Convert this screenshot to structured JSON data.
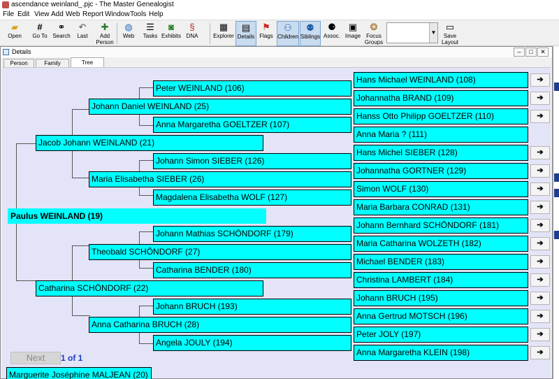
{
  "title_bar": {
    "text": "ascendance weinland_.pjc - The Master Genealogist"
  },
  "menu": [
    "File",
    "Edit",
    "View",
    "Add",
    "Web",
    "Report",
    "Window",
    "Tools",
    "Help"
  ],
  "toolbar": {
    "open": "Open",
    "go_to": "Go To",
    "search": "Search",
    "last": "Last",
    "add_person_1": "Add",
    "add_person_2": "Person",
    "web": "Web",
    "tasks": "Tasks",
    "exhibits": "Exhibits",
    "dna": "DNA",
    "explorer": "Explorer",
    "details": "Details",
    "flags": "Flags",
    "children": "Children",
    "siblings": "Siblings",
    "assoc": "Assoc.",
    "image": "Image",
    "focus_groups_1": "Focus",
    "focus_groups_2": "Groups",
    "save_layout_1": "Save",
    "save_layout_2": "Layout"
  },
  "details_window": {
    "title": "Details",
    "tabs": [
      "Person",
      "Family",
      "Tree"
    ],
    "active_tab": "Tree"
  },
  "tree": {
    "root": "Paulus WEINLAND (19)",
    "generation2": [
      "Jacob Johann WEINLAND (21)",
      "Catharina SCHÖNDORF (22)"
    ],
    "generation3": [
      "Johann Daniel WEINLAND (25)",
      "Maria Elisabetha SIEBER (26)",
      "Theobald SCHÖNDORF (27)",
      "Anna Catharina BRUCH (28)"
    ],
    "generation4": [
      "Peter WEINLAND (106)",
      "Anna Margaretha GOELTZER (107)",
      "Johann Simon SIEBER (126)",
      "Magdalena Elisabetha WOLF (127)",
      "Johann Mathias SCHÖNDORF (179)",
      "Catharina BENDER (180)",
      "Johann BRUCH (193)",
      "Angela JOULY (194)"
    ],
    "generation5": [
      {
        "name": "Hans Michael WEINLAND (108)",
        "has_arrow": true
      },
      {
        "name": "Johannatha BRAND (109)",
        "has_arrow": true
      },
      {
        "name": "Hanss Otto Philipp GOELTZER (110)",
        "has_arrow": true
      },
      {
        "name": "Anna Maria ? (111)",
        "has_arrow": false
      },
      {
        "name": "Hans Michel SIEBER (128)",
        "has_arrow": true
      },
      {
        "name": "Johannatha GORTNER (129)",
        "has_arrow": true
      },
      {
        "name": "Simon WOLF (130)",
        "has_arrow": true
      },
      {
        "name": "Maria Barbara CONRAD (131)",
        "has_arrow": true
      },
      {
        "name": "Johann Bernhard SCHÖNDORF (181)",
        "has_arrow": true
      },
      {
        "name": "Maria Catharina WOLZETH (182)",
        "has_arrow": true
      },
      {
        "name": "Michael BENDER (183)",
        "has_arrow": true
      },
      {
        "name": "Christina LAMBERT (184)",
        "has_arrow": true
      },
      {
        "name": "Johann BRUCH (195)",
        "has_arrow": true
      },
      {
        "name": "Anna Gertrud MOTSCH (196)",
        "has_arrow": true
      },
      {
        "name": "Peter JOLY (197)",
        "has_arrow": true
      },
      {
        "name": "Anna Margaretha KLEIN (198)",
        "has_arrow": true
      }
    ],
    "spouse": "Marguerite Joséphine MALJEAN (20)",
    "arrow_glyph": "➔"
  },
  "navigation": {
    "next_label": "Next",
    "page_text": "1 of  1"
  },
  "colors": {
    "person_box": "#00ffff",
    "tree_background": "#e4e4f8",
    "page_text": "#1a3fbf"
  }
}
